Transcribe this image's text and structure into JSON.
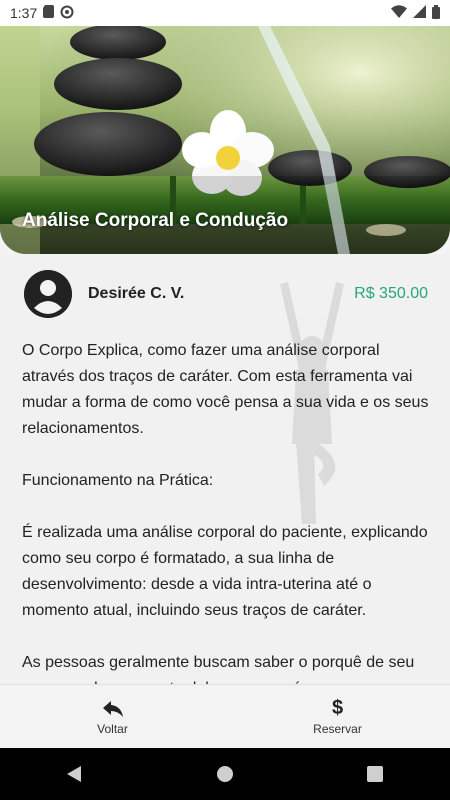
{
  "status_bar": {
    "time": "1:37"
  },
  "hero": {
    "title": "Análise Corporal e Condução"
  },
  "provider": {
    "name": "Desirée C. V.",
    "price": "R$ 350.00"
  },
  "description": {
    "paragraphs": [
      "O Corpo Explica, como fazer uma análise corporal através dos traços de caráter. Com esta ferramenta vai mudar a forma de como você pensa a sua vida e os seus relacionamentos.",
      "Funcionamento na Prática:",
      "É realizada uma análise corporal do paciente, explicando como seu corpo é formatado, a sua linha de desenvolvimento: desde a vida intra-uterina até o momento atual, incluindo seus traços de caráter.",
      "As pessoas geralmente buscam saber o porquê de seu corpo ou de uma parte dele ser como é e"
    ]
  },
  "bottom_bar": {
    "back_label": "Voltar",
    "reserve_label": "Reservar"
  },
  "colors": {
    "price": "#2aa57a",
    "nav_bar": "#000000"
  }
}
